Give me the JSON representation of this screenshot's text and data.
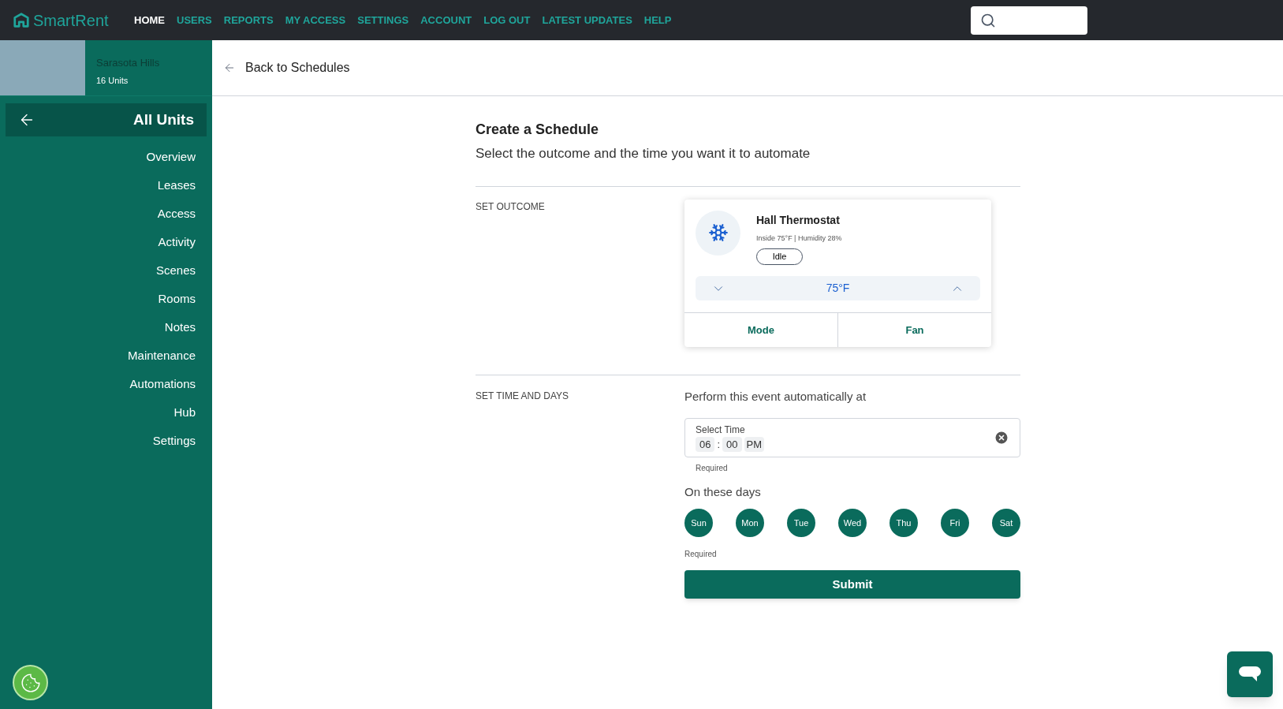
{
  "brand": "SmartRent",
  "nav": [
    {
      "label": "HOME",
      "selected": true
    },
    {
      "label": "USERS",
      "selected": false
    },
    {
      "label": "REPORTS",
      "selected": false
    },
    {
      "label": "MY ACCESS",
      "selected": false
    },
    {
      "label": "SETTINGS",
      "selected": false
    },
    {
      "label": "ACCOUNT",
      "selected": false
    },
    {
      "label": "LOG OUT",
      "selected": false
    },
    {
      "label": "LATEST UPDATES",
      "selected": false
    },
    {
      "label": "HELP",
      "selected": false
    }
  ],
  "property": {
    "name": "Sarasota Hills",
    "units": "16 Units"
  },
  "sidebar": {
    "title": "All Units",
    "items": [
      "Overview",
      "Leases",
      "Access",
      "Activity",
      "Scenes",
      "Rooms",
      "Notes",
      "Maintenance",
      "Automations",
      "Hub",
      "Settings"
    ]
  },
  "back_link": "Back to Schedules",
  "heading": "Create a Schedule",
  "subheading": "Select the outcome and the time you want it to automate",
  "outcome": {
    "label": "SET OUTCOME",
    "device": "Hall Thermostat",
    "details": "Inside 75°F | Humidity 28%",
    "status": "Idle",
    "setpoint": "75°F",
    "buttons": [
      "Mode",
      "Fan"
    ]
  },
  "time": {
    "label": "SET TIME AND DAYS",
    "prompt": "Perform this event automatically at",
    "field_label": "Select Time",
    "hour": "06",
    "separator": ":",
    "minute": "00",
    "period": "PM",
    "hint": "Required"
  },
  "days": {
    "label": "On these days",
    "items": [
      {
        "label": "Sun",
        "selected": true
      },
      {
        "label": "Mon",
        "selected": true
      },
      {
        "label": "Tue",
        "selected": true
      },
      {
        "label": "Wed",
        "selected": true
      },
      {
        "label": "Thu",
        "selected": true
      },
      {
        "label": "Fri",
        "selected": true
      },
      {
        "label": "Sat",
        "selected": true
      }
    ],
    "hint": "Required"
  },
  "submit": "Submit"
}
